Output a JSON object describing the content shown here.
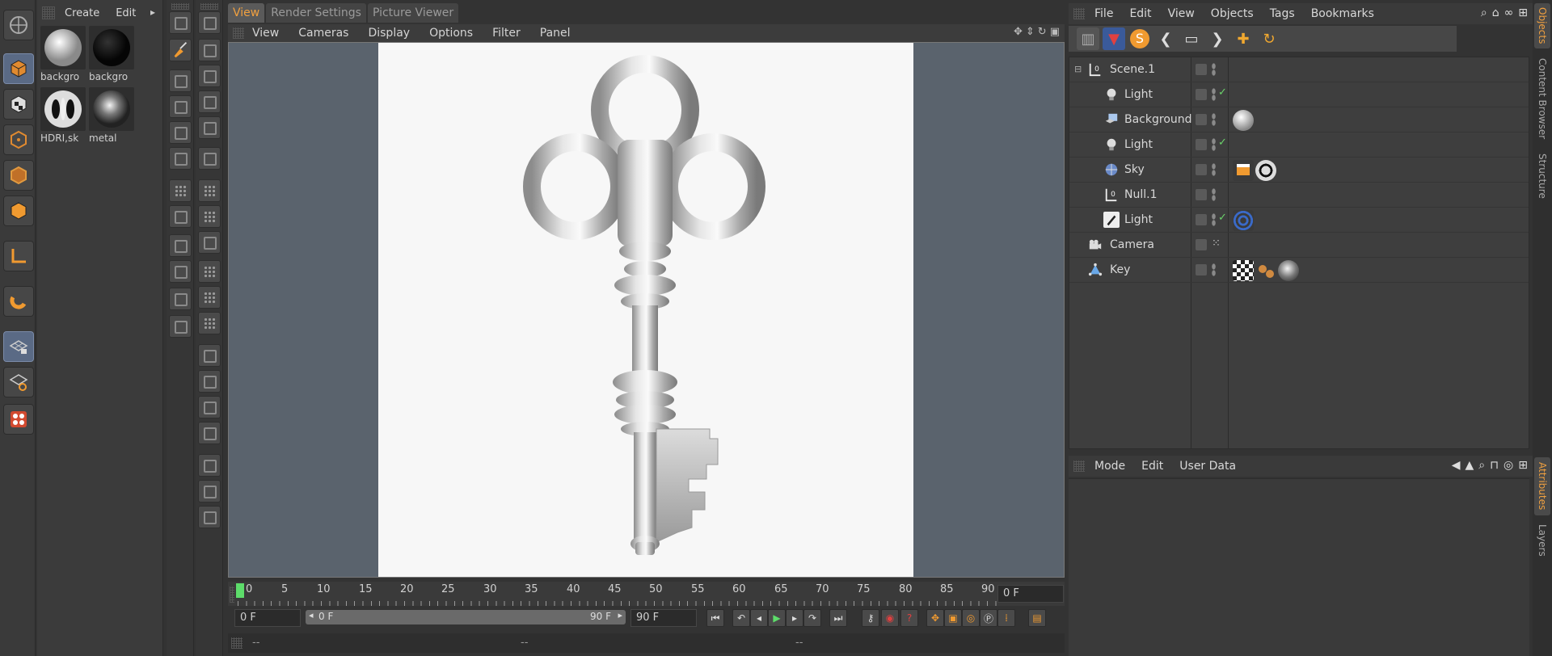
{
  "materials": {
    "menu": [
      "Create",
      "Edit"
    ],
    "items": [
      {
        "label": "backgro",
        "kind": "white"
      },
      {
        "label": "backgro",
        "kind": "black"
      },
      {
        "label": "HDRI,sk",
        "kind": "hdri"
      },
      {
        "label": "metal",
        "kind": "metal"
      }
    ]
  },
  "view": {
    "tabs": [
      "View",
      "Render Settings",
      "Picture Viewer"
    ],
    "menu": [
      "View",
      "Cameras",
      "Display",
      "Options",
      "Filter",
      "Panel"
    ]
  },
  "timeline": {
    "ticks": [
      "0",
      "5",
      "10",
      "15",
      "20",
      "25",
      "30",
      "35",
      "40",
      "45",
      "50",
      "55",
      "60",
      "65",
      "70",
      "75",
      "80",
      "85",
      "90"
    ],
    "current_frame": "0 F"
  },
  "transport": {
    "start": "0 F",
    "range_start": "0 F",
    "range_end": "90 F",
    "end": "90 F"
  },
  "status": {
    "a": "--",
    "b": "--",
    "c": "--"
  },
  "objects": {
    "menu": [
      "File",
      "Edit",
      "View",
      "Objects",
      "Tags",
      "Bookmarks"
    ],
    "rows": [
      {
        "name": "Scene.1",
        "icon": "null-icon",
        "check": ""
      },
      {
        "name": "Light",
        "icon": "light-icon",
        "check": "✓"
      },
      {
        "name": "Background",
        "icon": "background-icon",
        "check": ""
      },
      {
        "name": "Light",
        "icon": "light-icon",
        "check": "✓"
      },
      {
        "name": "Sky",
        "icon": "sky-icon",
        "check": ""
      },
      {
        "name": "Null.1",
        "icon": "null-icon",
        "check": ""
      },
      {
        "name": "Light",
        "icon": "spotlight-icon",
        "check": "✓"
      },
      {
        "name": "Camera",
        "icon": "camera-icon",
        "check": ""
      },
      {
        "name": "Key",
        "icon": "key-object-icon",
        "check": ""
      }
    ]
  },
  "attributes": {
    "menu": [
      "Mode",
      "Edit",
      "User Data"
    ]
  },
  "side_tabs": [
    "Objects",
    "Content Browser",
    "Structure",
    "Attributes",
    "Layers"
  ]
}
